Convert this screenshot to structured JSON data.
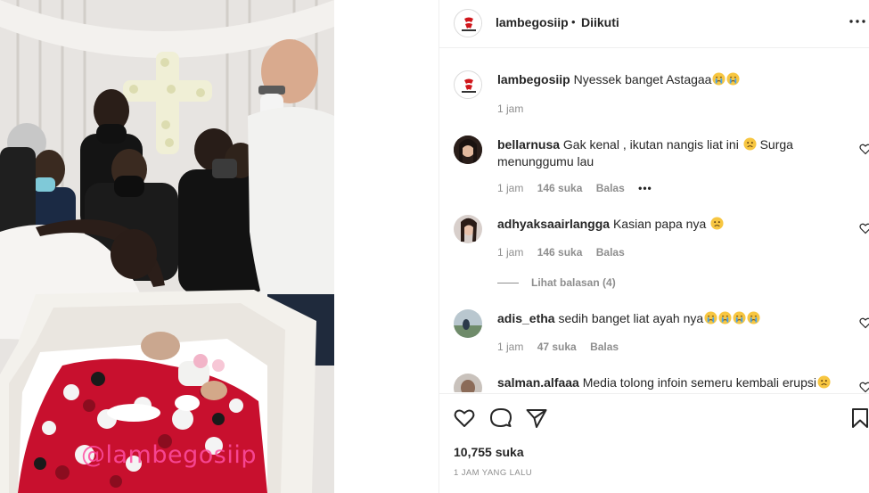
{
  "media": {
    "watermark": "@lambegosiip"
  },
  "post": {
    "author": "lambegosiip",
    "separator": "•",
    "follow_status": "Diikuti",
    "caption": {
      "user": "lambegosiip",
      "text": "Nyessek banget Astagaa",
      "emojis": [
        "crying-face-emoji",
        "crying-face-emoji"
      ],
      "time": "1 jam"
    },
    "comments": [
      {
        "user": "bellarnusa",
        "text": "Gak kenal , ikutan nangis liat ini",
        "emoji_mid": "sad-face-emoji",
        "text_after": "Surga menunggumu lau",
        "time": "1 jam",
        "likes": "146 suka",
        "reply": "Balas",
        "more": "•••"
      },
      {
        "user": "adhyaksaairlangga",
        "text": "Kasian papa nya",
        "emoji_end": "sad-face-emoji",
        "time": "1 jam",
        "likes": "146 suka",
        "reply": "Balas",
        "view_replies": "Lihat balasan (4)"
      },
      {
        "user": "adis_etha",
        "text": "sedih banget liat ayah nya",
        "emojis": [
          "crying-face-emoji",
          "crying-face-emoji",
          "crying-face-emoji",
          "crying-face-emoji"
        ],
        "time": "1 jam",
        "likes": "47 suka",
        "reply": "Balas"
      },
      {
        "user": "salman.alfaaa",
        "text": "Media tolong infoin semeru kembali erupsi",
        "emoji_end": "sad-face-emoji"
      }
    ],
    "like_count": "10,755 suka",
    "posted": "1 JAM YANG LALU"
  },
  "icons": {
    "like": "heart-outline-icon",
    "comment": "comment-bubble-icon",
    "share": "paper-plane-icon",
    "save": "bookmark-icon",
    "more": "more-dots-icon"
  },
  "colors": {
    "text": "#262626",
    "secondary": "#8e8e8e",
    "border": "#efefef",
    "emoji": "#f7c641",
    "watermark": "#ff4fa3"
  }
}
